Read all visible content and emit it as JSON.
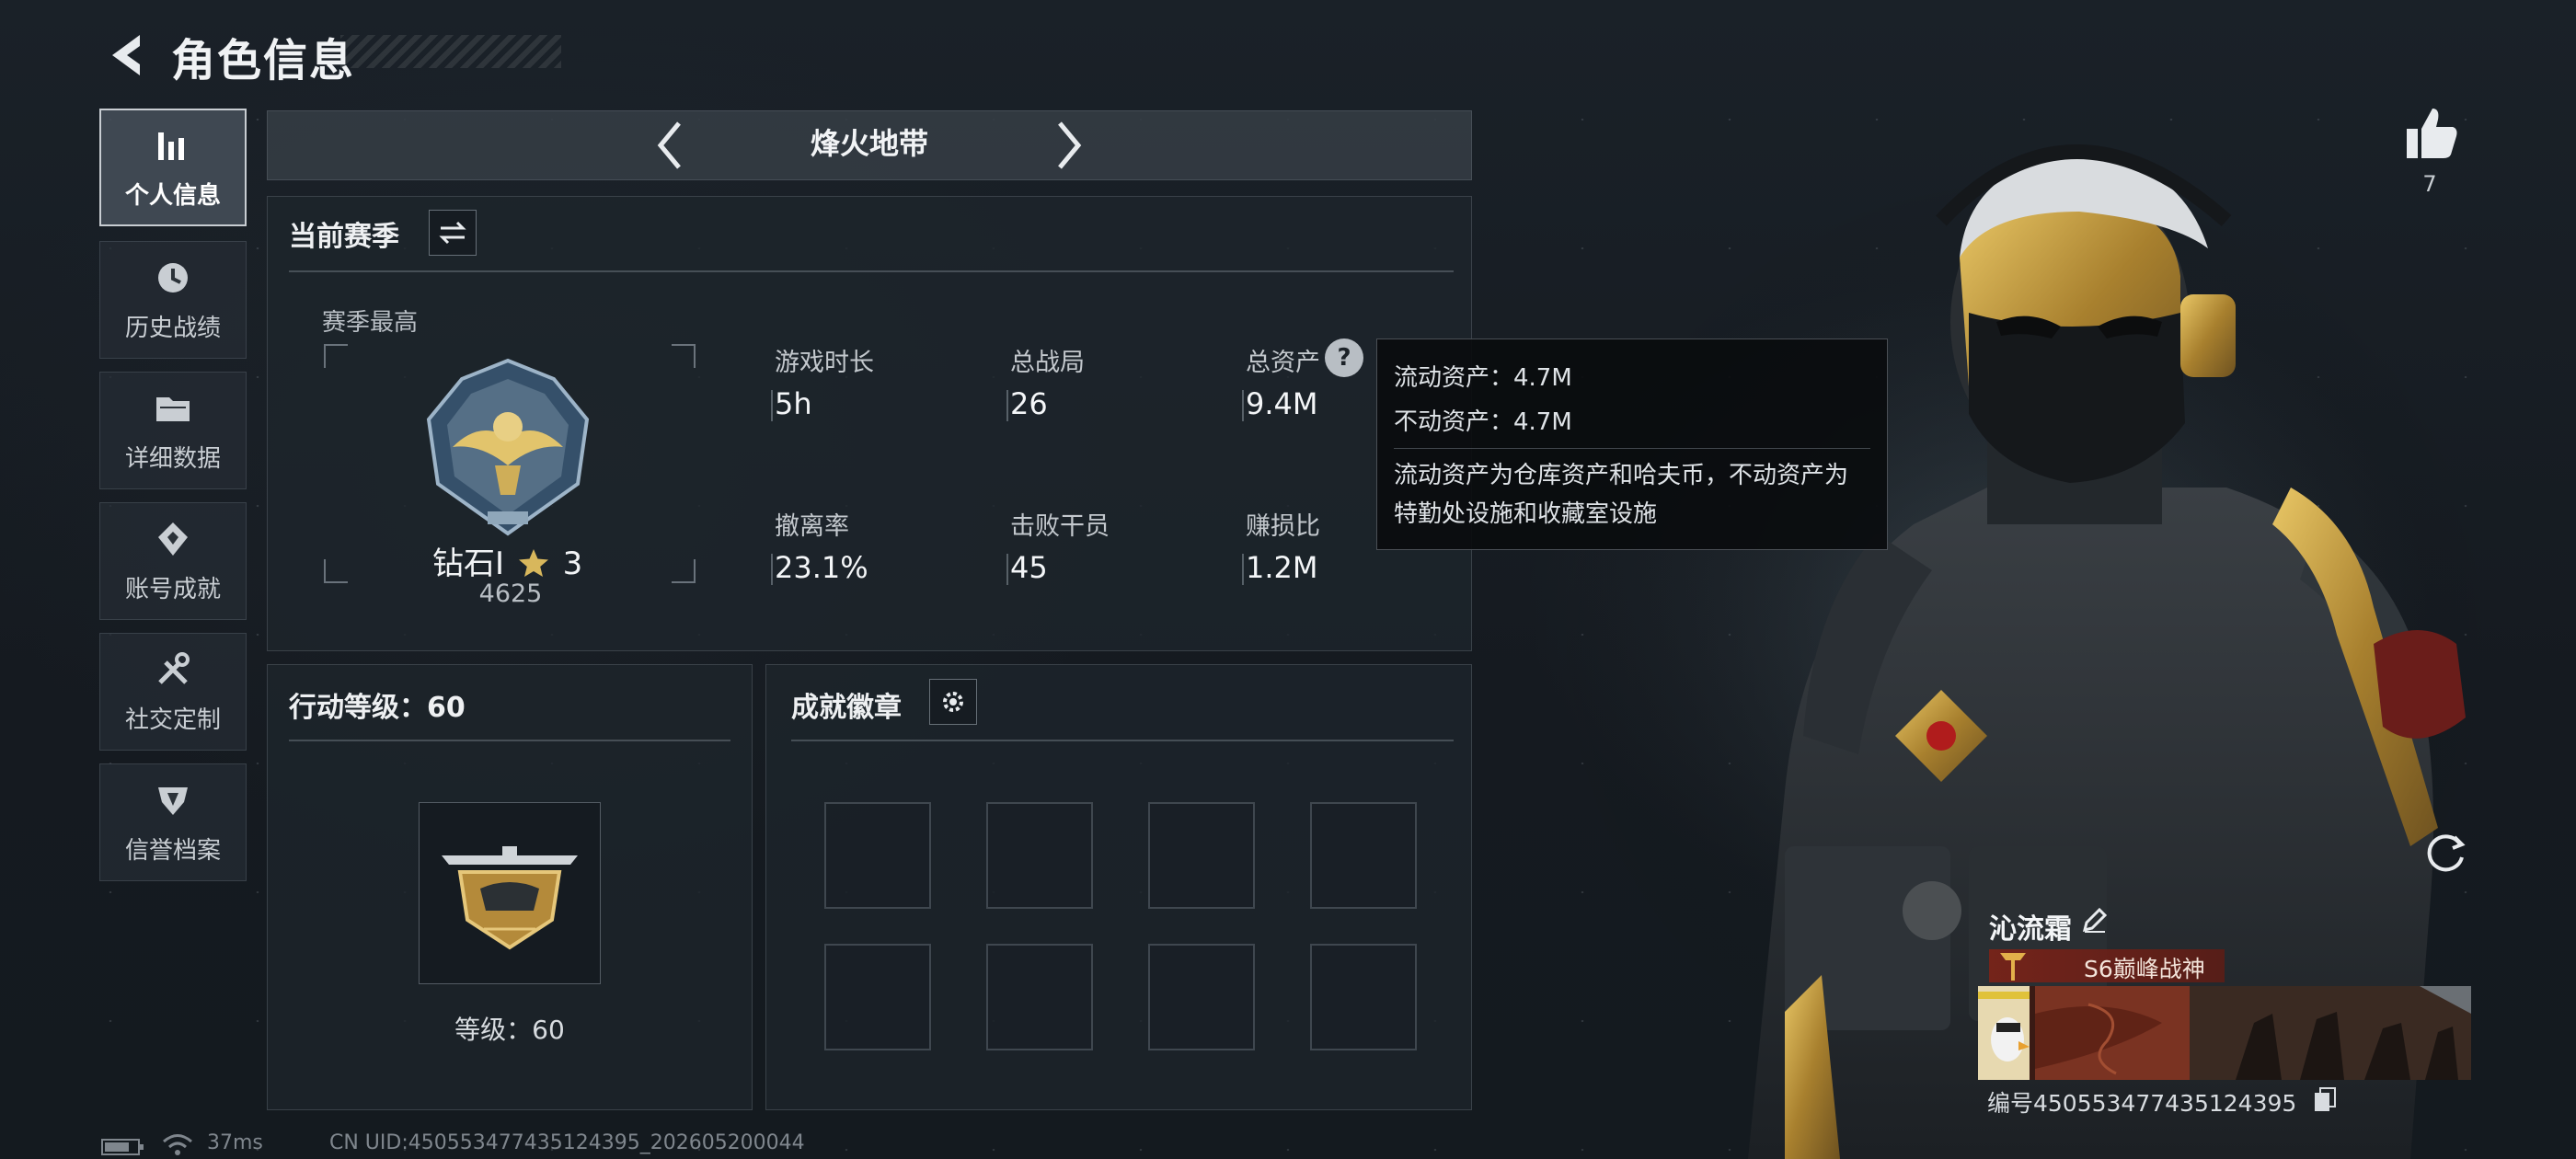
{
  "header": {
    "title": "角色信息",
    "back_icon": "back-arrow-icon"
  },
  "sidebar": {
    "items": [
      {
        "label": "个人信息",
        "icon": "bar-chart-icon",
        "active": true
      },
      {
        "label": "历史战绩",
        "icon": "history-clock-icon",
        "active": false
      },
      {
        "label": "详细数据",
        "icon": "folder-icon",
        "active": false
      },
      {
        "label": "账号成就",
        "icon": "achievement-icon",
        "active": false
      },
      {
        "label": "社交定制",
        "icon": "tools-icon",
        "active": false
      },
      {
        "label": "信誉档案",
        "icon": "credit-badge-icon",
        "active": false
      }
    ]
  },
  "mode": {
    "title": "烽火地带"
  },
  "season": {
    "title": "当前赛季",
    "best_label": "赛季最高",
    "rank_name": "钻石I",
    "rank_stars": "3",
    "rank_score": "4625",
    "stats": [
      {
        "label": "游戏时长",
        "value": "5h"
      },
      {
        "label": "总战局",
        "value": "26"
      },
      {
        "label": "总资产",
        "value": "9.4M"
      },
      {
        "label": "撤离率",
        "value": "23.1%"
      },
      {
        "label": "击败干员",
        "value": "45"
      },
      {
        "label": "赚损比",
        "value": "1.2M"
      }
    ]
  },
  "tooltip": {
    "liquid": "流动资产：4.7M",
    "fixed": "不动资产：4.7M",
    "desc": "流动资产为仓库资产和哈夫币，不动资产为特勤处设施和收藏室设施"
  },
  "action_level": {
    "title": "行动等级：60",
    "level_text": "等级：60"
  },
  "badges": {
    "title": "成就徽章"
  },
  "status_bar": {
    "ping": "37ms",
    "uid": "CN UID:450553477435124395_202605200044"
  },
  "profile": {
    "likes": "7",
    "player_name": "沁流霜",
    "player_title": "S6巅峰战神",
    "player_id": "编号450553477435124395"
  },
  "colors": {
    "accent": "#c8a24a",
    "title_banner": "#7a2319",
    "panel_bg": "#1e252c"
  }
}
